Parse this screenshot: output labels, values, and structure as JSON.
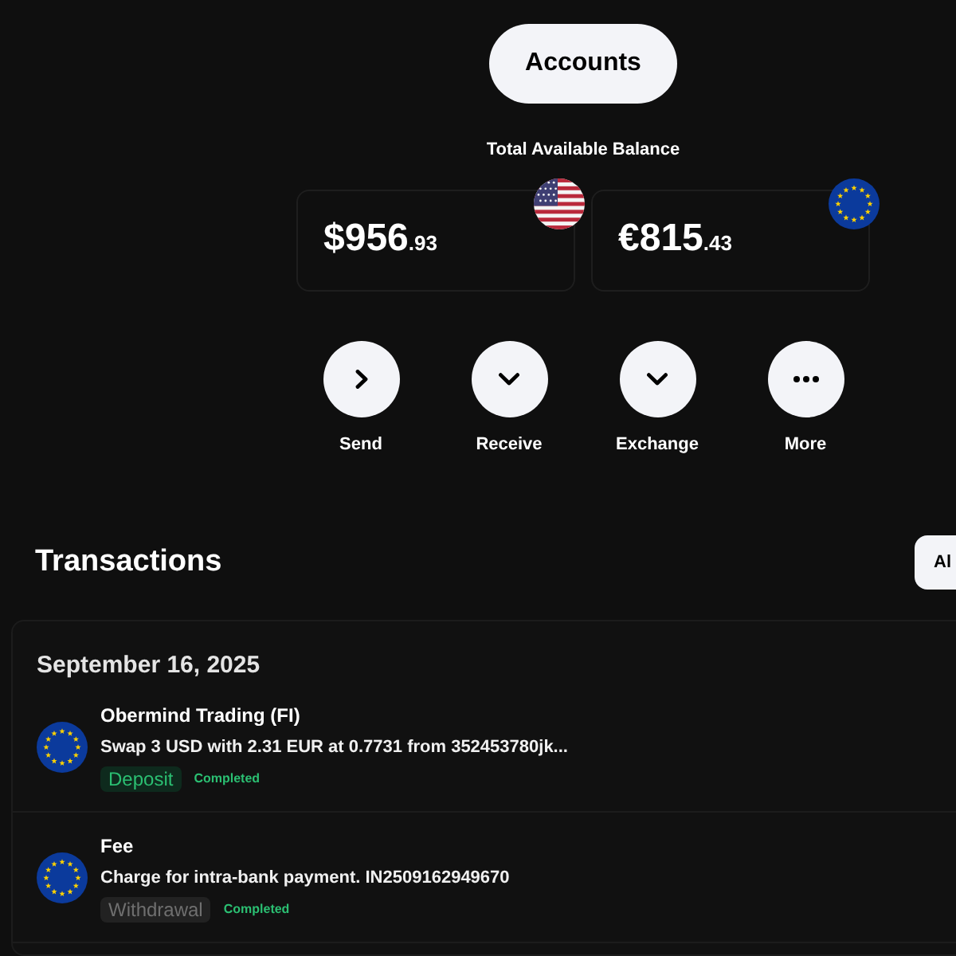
{
  "header": {
    "accounts_button": "Accounts",
    "balance_label": "Total Available Balance"
  },
  "accounts": [
    {
      "kind": "us",
      "whole": "$956",
      "fraction": ".93"
    },
    {
      "kind": "eu",
      "whole": "€815",
      "fraction": ".43"
    }
  ],
  "actions": [
    {
      "kind": "right",
      "label": "Send"
    },
    {
      "kind": "down",
      "label": "Receive"
    },
    {
      "kind": "down",
      "label": "Exchange"
    },
    {
      "kind": "dots",
      "label": "More"
    }
  ],
  "transactions": {
    "title": "Transactions",
    "filter_button": "Al",
    "groups": [
      {
        "date": "September 16, 2025",
        "items": [
          {
            "title": "Obermind Trading (FI)",
            "description": "Swap 3 USD with 2.31 EUR at 0.7731 from 352453780jk...",
            "type": {
              "label": "Deposit",
              "kind": "deposit"
            },
            "status": "Completed"
          },
          {
            "title": "Fee",
            "description": "Charge for intra-bank payment. IN2509162949670",
            "type": {
              "label": "Withdrawal",
              "kind": "withdrawal"
            },
            "status": "Completed"
          }
        ]
      }
    ]
  }
}
